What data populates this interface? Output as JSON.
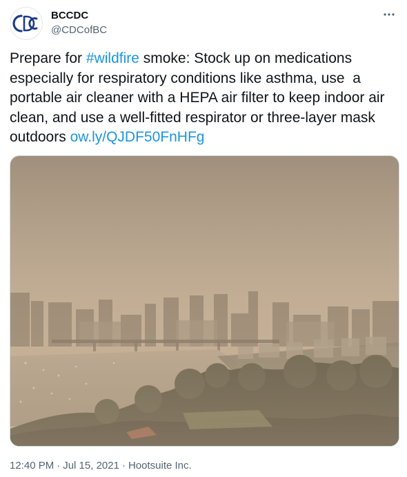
{
  "author": {
    "avatar_icon": "bccdc-logo-icon",
    "display_name": "BCCDC",
    "handle": "@CDCofBC"
  },
  "more_icon": "more-horizontal-icon",
  "tweet": {
    "text_before_hashtag": "Prepare for ",
    "hashtag": "#wildfire",
    "text_after_hashtag": " smoke: Stock up on medications especially for respiratory conditions like asthma, use  a portable air cleaner with a HEPA air filter to keep indoor air clean, and use a well-fitted respirator or three-layer mask outdoors ",
    "link": "ow.ly/QJDF50FnHFg"
  },
  "media": {
    "kind": "photo",
    "subject": "hazy smoke-covered city skyline and waterway"
  },
  "meta": {
    "time": "12:40 PM",
    "separator": "·",
    "date": "Jul 15, 2021",
    "source": "Hootsuite Inc."
  },
  "colors": {
    "link": "#1b95e0",
    "secondary_text": "#536471",
    "primary_text": "#0f1419",
    "logo_blue": "#1f3c88"
  }
}
